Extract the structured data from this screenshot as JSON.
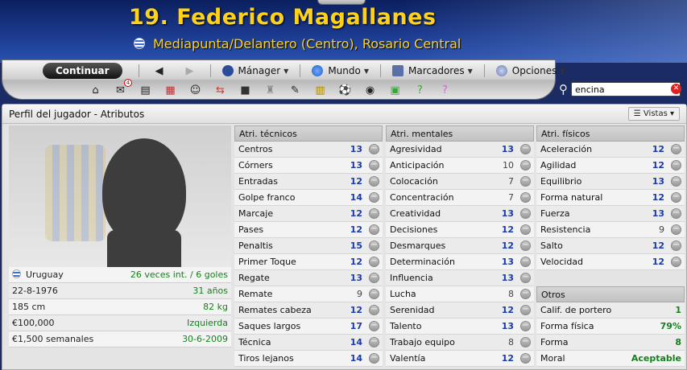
{
  "header": {
    "title": "19. Federico Magallanes",
    "subtitle": "Mediapunta/Delantero (Centro), Rosario Central"
  },
  "toolbar": {
    "continue_label": "Continuar",
    "menus": [
      {
        "label": "Mánager",
        "icon": "manager-icon"
      },
      {
        "label": "Mundo",
        "icon": "globe-icon"
      },
      {
        "label": "Marcadores",
        "icon": "bookmarks-icon"
      },
      {
        "label": "Opciones",
        "icon": "options-icon"
      }
    ],
    "icons": [
      "home-icon",
      "inbox-icon",
      "news-icon",
      "calendar-icon",
      "squad-icon",
      "transfers-icon",
      "tactics-icon",
      "trophy-icon",
      "scout-icon",
      "notes-icon",
      "match-icon",
      "binoculars-icon",
      "finances-icon",
      "help-icon",
      "question-icon"
    ],
    "inbox_badge": "4"
  },
  "search": {
    "value": "encina"
  },
  "panel": {
    "title": "Perfil del jugador - Atributos",
    "views_label": "Vistas"
  },
  "player_info": [
    {
      "label": "Uruguay",
      "value": "26 veces int. / 6 goles",
      "flag": true
    },
    {
      "label": "22-8-1976",
      "value": "31 años"
    },
    {
      "label": "185 cm",
      "value": "82 kg"
    },
    {
      "label": "€100,000",
      "value": "Izquierda"
    },
    {
      "label": "€1,500 semanales",
      "value": "30-6-2009"
    }
  ],
  "technical": {
    "title": "Atri. técnicos",
    "rows": [
      {
        "label": "Centros",
        "value": "13"
      },
      {
        "label": "Córners",
        "value": "13"
      },
      {
        "label": "Entradas",
        "value": "12"
      },
      {
        "label": "Golpe franco",
        "value": "14"
      },
      {
        "label": "Marcaje",
        "value": "12"
      },
      {
        "label": "Pases",
        "value": "12"
      },
      {
        "label": "Penaltis",
        "value": "15"
      },
      {
        "label": "Primer Toque",
        "value": "12"
      },
      {
        "label": "Regate",
        "value": "13"
      },
      {
        "label": "Remate",
        "value": "9"
      },
      {
        "label": "Remates cabeza",
        "value": "12"
      },
      {
        "label": "Saques largos",
        "value": "17"
      },
      {
        "label": "Técnica",
        "value": "14"
      },
      {
        "label": "Tiros lejanos",
        "value": "14"
      }
    ]
  },
  "mental": {
    "title": "Atri. mentales",
    "rows": [
      {
        "label": "Agresividad",
        "value": "13"
      },
      {
        "label": "Anticipación",
        "value": "10"
      },
      {
        "label": "Colocación",
        "value": "7"
      },
      {
        "label": "Concentración",
        "value": "7"
      },
      {
        "label": "Creatividad",
        "value": "13"
      },
      {
        "label": "Decisiones",
        "value": "12"
      },
      {
        "label": "Desmarques",
        "value": "12"
      },
      {
        "label": "Determinación",
        "value": "13"
      },
      {
        "label": "Influencia",
        "value": "13"
      },
      {
        "label": "Lucha",
        "value": "8"
      },
      {
        "label": "Serenidad",
        "value": "12"
      },
      {
        "label": "Talento",
        "value": "13"
      },
      {
        "label": "Trabajo equipo",
        "value": "8"
      },
      {
        "label": "Valentía",
        "value": "12"
      }
    ]
  },
  "physical": {
    "title": "Atri. físicos",
    "rows": [
      {
        "label": "Aceleración",
        "value": "12"
      },
      {
        "label": "Agilidad",
        "value": "12"
      },
      {
        "label": "Equilibrio",
        "value": "13"
      },
      {
        "label": "Forma natural",
        "value": "12"
      },
      {
        "label": "Fuerza",
        "value": "13"
      },
      {
        "label": "Resistencia",
        "value": "9"
      },
      {
        "label": "Salto",
        "value": "12"
      },
      {
        "label": "Velocidad",
        "value": "12"
      }
    ]
  },
  "others": {
    "title": "Otros",
    "rows": [
      {
        "label": "Calif. de portero",
        "value": "1"
      },
      {
        "label": "Forma física",
        "value": "79%"
      },
      {
        "label": "Forma",
        "value": "8"
      },
      {
        "label": "Moral",
        "value": "Aceptable"
      }
    ]
  },
  "colors": {
    "title_yellow": "#ffd21a",
    "value_blue": "#1a3aa8",
    "value_green": "#15801d",
    "header_blue": "#1b3a8f"
  }
}
